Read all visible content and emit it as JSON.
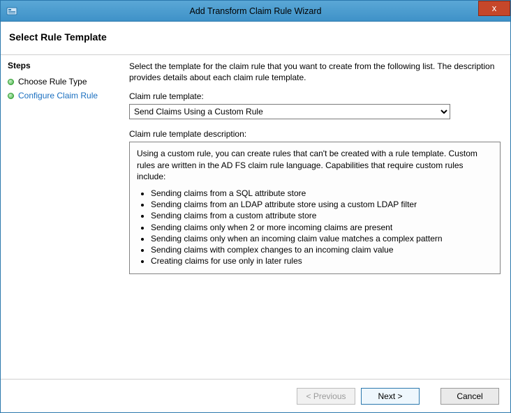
{
  "window": {
    "title": "Add Transform Claim Rule Wizard",
    "close_icon": "x"
  },
  "header": {
    "title": "Select Rule Template"
  },
  "steps": {
    "heading": "Steps",
    "items": [
      {
        "label": "Choose Rule Type",
        "active": false
      },
      {
        "label": "Configure Claim Rule",
        "active": true
      }
    ]
  },
  "main": {
    "intro": "Select the template for the claim rule that you want to create from the following list. The description provides details about each claim rule template.",
    "template_label": "Claim rule template:",
    "template_selected": "Send Claims Using a Custom Rule",
    "description_label": "Claim rule template description:",
    "description_intro": "Using a custom rule, you can create rules that can't be created with a rule template.  Custom rules are written in the AD FS claim rule language.  Capabilities that require custom rules include:",
    "description_bullets": [
      "Sending claims from a SQL attribute store",
      "Sending claims from an LDAP attribute store using a custom LDAP filter",
      "Sending claims from a custom attribute store",
      "Sending claims only when 2 or more incoming claims are present",
      "Sending claims only when an incoming claim value matches a complex pattern",
      "Sending claims with complex changes to an incoming claim value",
      "Creating claims for use only in later rules"
    ]
  },
  "footer": {
    "previous": "< Previous",
    "next": "Next >",
    "cancel": "Cancel"
  }
}
